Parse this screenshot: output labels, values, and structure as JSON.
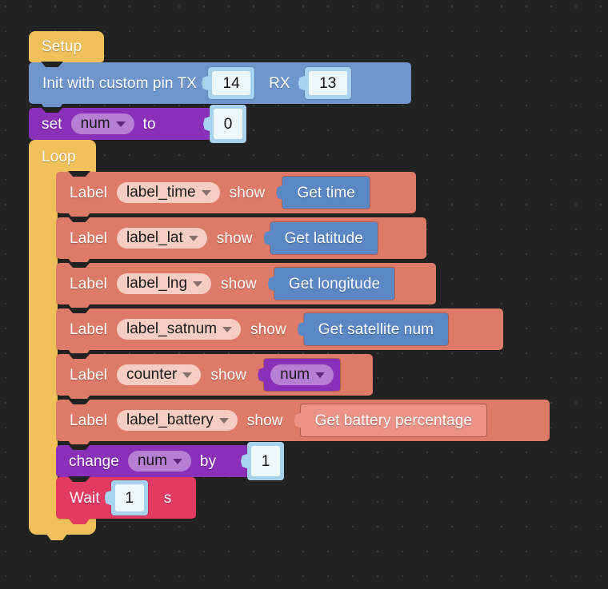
{
  "canvas": {
    "background_color": "#222222",
    "grid_dot_color": "#3d3d3d",
    "grid_spacing_px": 31
  },
  "palette": {
    "hat_yellow": "#f0c15a",
    "serial_blue": "#6e96cd",
    "variable_purple": "#8a2fb8",
    "variable_purple_field": "#b77fd4",
    "label_salmon": "#dd7a68",
    "label_field_pink": "#f6cdc3",
    "reporter_blue": "#5b87c5",
    "reporter_pink": "#ec9387",
    "wait_crimson": "#e33a62",
    "numslot_blue": "#a8d3ef",
    "numfield_white": "#eef7fb"
  },
  "setup": {
    "hat_label": "Setup"
  },
  "init_block": {
    "text_before_tx": "Init with custom pin TX",
    "tx_value": "14",
    "rx_label": "RX",
    "rx_value": "13"
  },
  "set_block": {
    "verb": "set",
    "variable": "num",
    "preposition": "to",
    "value": "0"
  },
  "loop": {
    "hat_label": "Loop"
  },
  "label_rows": [
    {
      "verb": "Label",
      "target": "label_time",
      "action": "show",
      "reporter": "Get time",
      "reporter_kind": "blue"
    },
    {
      "verb": "Label",
      "target": "label_lat",
      "action": "show",
      "reporter": "Get latitude",
      "reporter_kind": "blue"
    },
    {
      "verb": "Label",
      "target": "label_lng",
      "action": "show",
      "reporter": "Get longitude",
      "reporter_kind": "blue"
    },
    {
      "verb": "Label",
      "target": "label_satnum",
      "action": "show",
      "reporter": "Get satellite num",
      "reporter_kind": "blue"
    },
    {
      "verb": "Label",
      "target": "counter",
      "action": "show",
      "reporter": "num",
      "reporter_kind": "variable"
    },
    {
      "verb": "Label",
      "target": "label_battery",
      "action": "show",
      "reporter": "Get battery percentage",
      "reporter_kind": "pink"
    }
  ],
  "change_block": {
    "verb": "change",
    "variable": "num",
    "preposition": "by",
    "value": "1"
  },
  "wait_block": {
    "verb": "Wait",
    "value": "1",
    "unit": "s"
  }
}
